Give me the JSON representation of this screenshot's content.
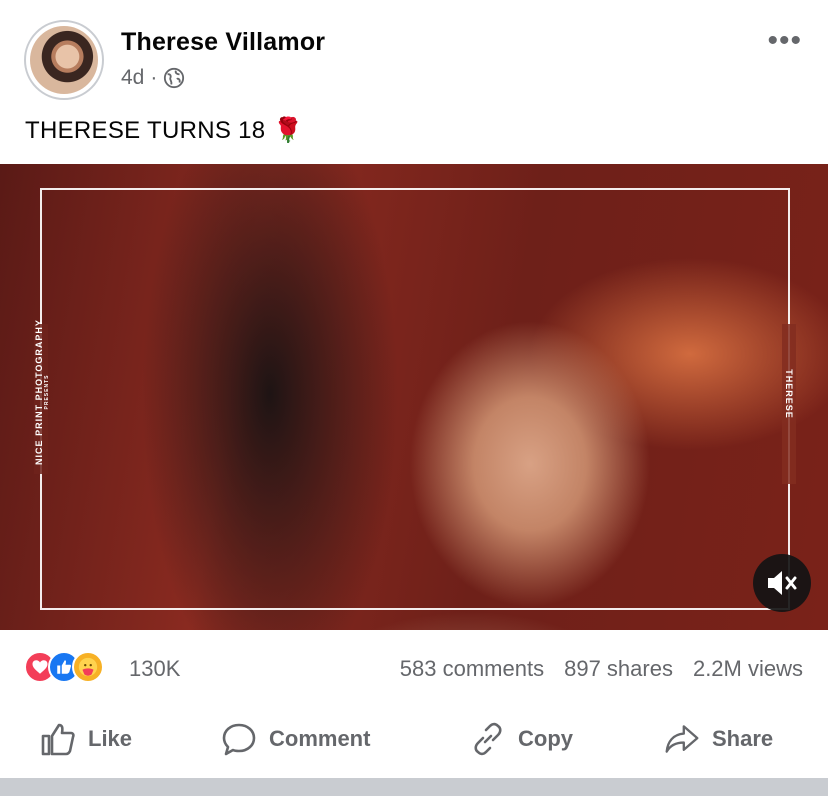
{
  "post": {
    "author": "Therese Villamor",
    "time": "4d",
    "separator": "·",
    "caption": "THERESE TURNS 18",
    "caption_emoji": "🌹",
    "more_icon": "more-dots-icon"
  },
  "video": {
    "watermark_left": "NICE PRINT PHOTOGRAPHY",
    "watermark_left_small": "PRESENTS",
    "watermark_right": "THERESE",
    "muted": true
  },
  "stats": {
    "reaction_types": [
      "love",
      "like",
      "care"
    ],
    "reaction_count": "130K",
    "comments": "583 comments",
    "shares": "897 shares",
    "views": "2.2M views"
  },
  "actions": {
    "like": "Like",
    "comment": "Comment",
    "copy": "Copy",
    "share": "Share"
  },
  "colors": {
    "text_secondary": "#65676b",
    "love": "#f33e58",
    "like": "#1877f2",
    "care": "#f7b125"
  }
}
